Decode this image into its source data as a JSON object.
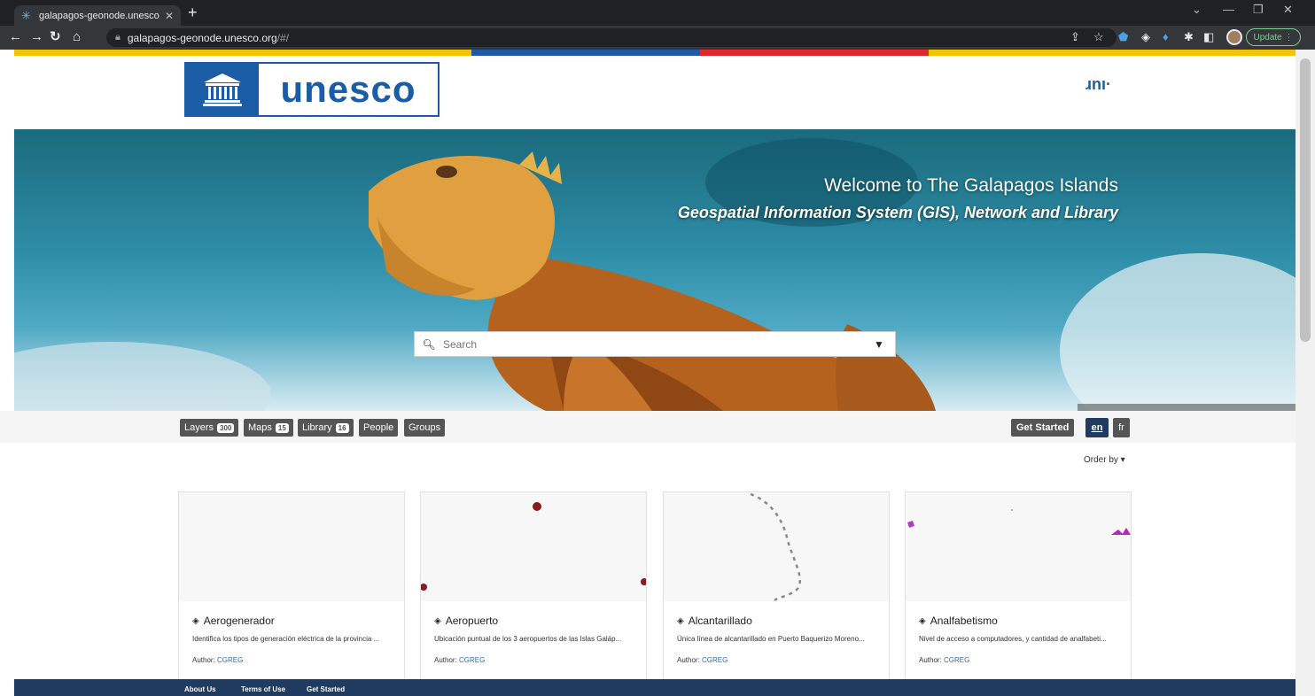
{
  "browser": {
    "tab_title": "galapagos-geonode.unesco.org",
    "tab_close": "✕",
    "new_tab": "+",
    "url_host": "galapagos-geonode.unesco.org",
    "url_path": "/#/",
    "update_label": "Update"
  },
  "header": {
    "logo_text": "unesco",
    "menu_glyph": "ɹnı·"
  },
  "hero": {
    "title": "Welcome to The Galapagos Islands",
    "subtitle": "Geospatial Information System (GIS), Network and Library",
    "search_placeholder": "Search"
  },
  "filters": {
    "tabs": [
      {
        "label": "Layers",
        "count": "300"
      },
      {
        "label": "Maps",
        "count": "15"
      },
      {
        "label": "Library",
        "count": "16"
      },
      {
        "label": "People",
        "count": ""
      },
      {
        "label": "Groups",
        "count": ""
      }
    ],
    "get_started": "Get Started",
    "lang_en": "en",
    "lang_fr": "fr",
    "order_by": "Order by ▾"
  },
  "cards": [
    {
      "title": "Aerogenerador",
      "description": "Identifica los tipos de generación eléctrica de la provincia ...",
      "author_label": "Author:",
      "author": "CGREG"
    },
    {
      "title": "Aeropuerto",
      "description": "Ubicación puntual de los 3 aeropuertos de las Islas Galáp...",
      "author_label": "Author:",
      "author": "CGREG"
    },
    {
      "title": "Alcantarillado",
      "description": "Única línea de alcantarillado en Puerto Baquerizo Moreno...",
      "author_label": "Author:",
      "author": "CGREG"
    },
    {
      "title": "Analfabetismo",
      "description": "Nivel de acceso a computadores, y cantidad de analfabeti...",
      "author_label": "Author:",
      "author": "CGREG"
    }
  ],
  "footer": {
    "about": "About Us",
    "terms": "Terms of Use",
    "get_started": "Get Started"
  },
  "colors": {
    "brand_blue": "#1a5da6",
    "stripe_yellow": "#f5c400",
    "stripe_blue": "#1f5aa8",
    "stripe_red": "#e3262b",
    "footer_bg": "#1f3b5f",
    "lang_active": "#1f3b5f"
  }
}
